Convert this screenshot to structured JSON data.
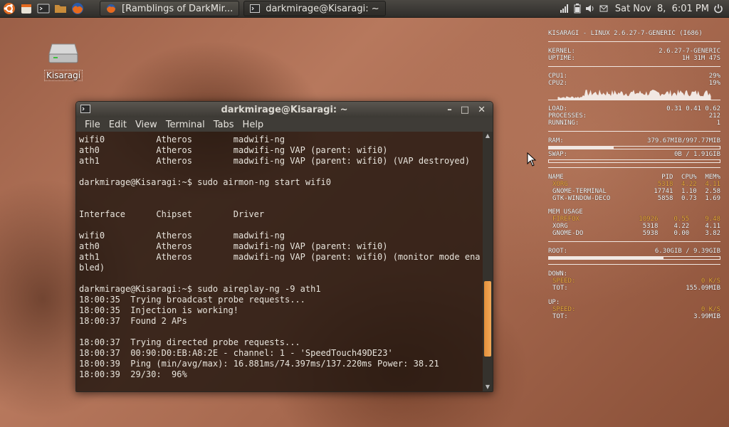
{
  "panel": {
    "tasks": [
      {
        "label": "[Ramblings of DarkMir...",
        "icon": "firefox-icon"
      },
      {
        "label": "darkmirage@Kisaragi: ~",
        "icon": "terminal-icon"
      }
    ],
    "clock": "Sat Nov  8,  6:01 PM"
  },
  "desktop": {
    "icon_label": "Kisaragi"
  },
  "terminal": {
    "title": "darkmirage@Kisaragi: ~",
    "menu": [
      "File",
      "Edit",
      "View",
      "Terminal",
      "Tabs",
      "Help"
    ],
    "lines": [
      "wifi0          Atheros        madwifi-ng",
      "ath0           Atheros        madwifi-ng VAP (parent: wifi0)",
      "ath1           Atheros        madwifi-ng VAP (parent: wifi0) (VAP destroyed)",
      "",
      "darkmirage@Kisaragi:~$ sudo airmon-ng start wifi0",
      "",
      "",
      "Interface      Chipset        Driver",
      "",
      "wifi0          Atheros        madwifi-ng",
      "ath0           Atheros        madwifi-ng VAP (parent: wifi0)",
      "ath1           Atheros        madwifi-ng VAP (parent: wifi0) (monitor mode ena",
      "bled)",
      "",
      "darkmirage@Kisaragi:~$ sudo aireplay-ng -9 ath1",
      "18:00:35  Trying broadcast probe requests...",
      "18:00:35  Injection is working!",
      "18:00:37  Found 2 APs",
      "",
      "18:00:37  Trying directed probe requests...",
      "18:00:37  00:90:D0:EB:A8:2E - channel: 1 - 'SpeedTouch49DE23'",
      "18:00:39  Ping (min/avg/max): 16.881ms/74.397ms/137.220ms Power: 38.21",
      "18:00:39  29/30:  96%"
    ]
  },
  "conky": {
    "header": "KISARAGI - LINUX 2.6.27-7-GENERIC (I686)",
    "kernel_label": "KERNEL:",
    "kernel": "2.6.27-7-GENERIC",
    "uptime_label": "UPTIME:",
    "uptime": "1H 31M 47S",
    "cpu1_label": "CPU1:",
    "cpu1": "29%",
    "cpu2_label": "CPU2:",
    "cpu2": "19%",
    "load_label": "LOAD:",
    "load": "0.31 0.41 0.62",
    "processes_label": "PROCESSES:",
    "processes": "212",
    "running_label": "RUNNING:",
    "running": "1",
    "ram_label": "RAM:",
    "ram": "379.67MIB/997.77MIB",
    "ram_fraction": 0.38,
    "swap_label": "SWAP:",
    "swap": "0B / 1.91GIB",
    "swap_fraction": 0.0,
    "proc_headers": [
      "NAME",
      "PID",
      "CPU%",
      "MEM%"
    ],
    "cpu_procs": [
      [
        "XORG",
        "5318",
        "4.22",
        "4.11"
      ],
      [
        "GNOME-TERMINAL",
        "17741",
        "1.10",
        "2.58"
      ],
      [
        "GTK-WINDOW-DECO",
        "5858",
        "0.73",
        "1.69"
      ]
    ],
    "mem_title": "MEM USAGE",
    "mem_procs": [
      [
        "FIREFOX",
        "10926",
        "0.55",
        "9.48"
      ],
      [
        "XORG",
        "5318",
        "4.22",
        "4.11"
      ],
      [
        "GNOME-DO",
        "5938",
        "0.00",
        "3.82"
      ]
    ],
    "root_label": "ROOT:",
    "root": "6.30GIB / 9.39GIB",
    "root_fraction": 0.67,
    "down_label": "DOWN:",
    "down_speed_label": "SPEED:",
    "down_speed": "0 K/S",
    "down_tot_label": "TOT:",
    "down_tot": "155.09MIB",
    "up_label": "UP:",
    "up_speed_label": "SPEED:",
    "up_speed": "0 K/S",
    "up_tot_label": "TOT:",
    "up_tot": "3.99MIB",
    "accent_color": "#f3b03f"
  }
}
